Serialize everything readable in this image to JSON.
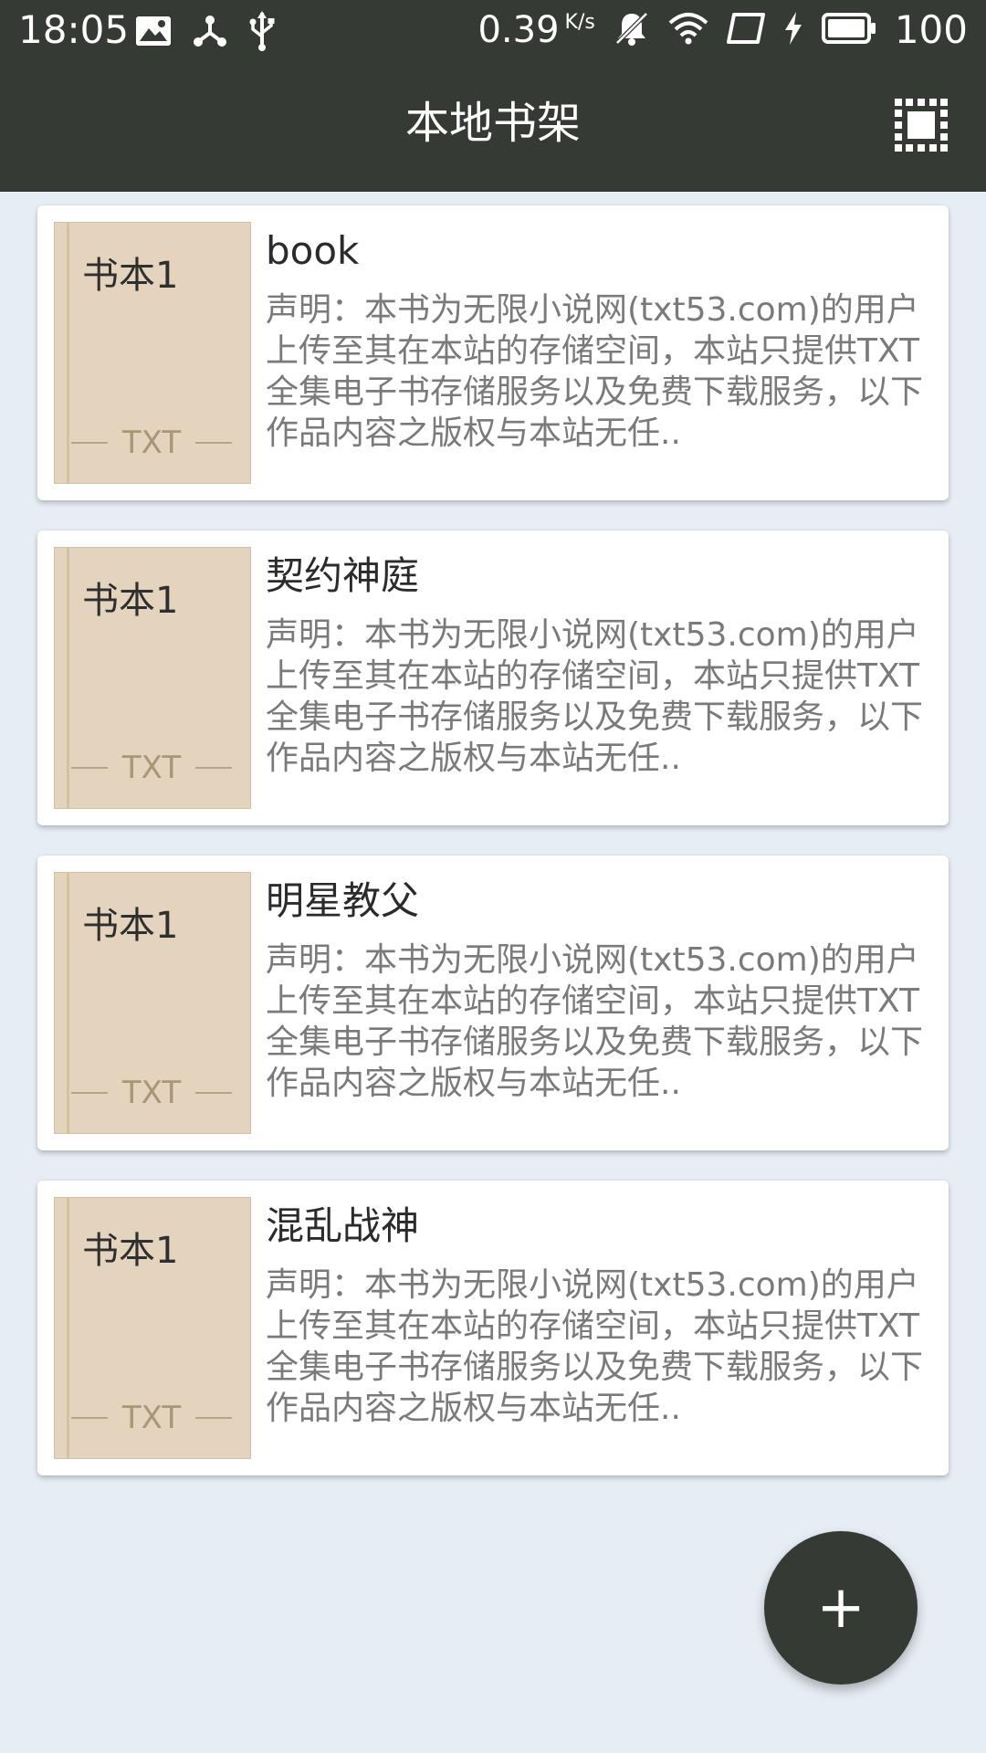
{
  "status_bar": {
    "time": "18:05",
    "net_speed_value": "0.39",
    "net_speed_unit": "K/s",
    "battery_level": "100",
    "icons": [
      "image-icon",
      "share-icon",
      "usb-icon",
      "mute-icon",
      "wifi-icon",
      "screen-icon",
      "charging-icon",
      "battery-icon"
    ]
  },
  "toolbar": {
    "title": "本地书架",
    "action_icon": "select-all-icon"
  },
  "books": [
    {
      "name": "book",
      "cover_title": "书本1",
      "cover_format": "TXT",
      "description": "声明：本书为无限小说网(txt53.com)的用户上传至其在本站的存储空间，本站只提供TXT全集电子书存储服务以及免费下载服务，以下作品内容之版权与本站无任.."
    },
    {
      "name": "契约神庭",
      "cover_title": "书本1",
      "cover_format": "TXT",
      "description": "声明：本书为无限小说网(txt53.com)的用户上传至其在本站的存储空间，本站只提供TXT全集电子书存储服务以及免费下载服务，以下作品内容之版权与本站无任.."
    },
    {
      "name": "明星教父",
      "cover_title": "书本1",
      "cover_format": "TXT",
      "description": "声明：本书为无限小说网(txt53.com)的用户上传至其在本站的存储空间，本站只提供TXT全集电子书存储服务以及免费下载服务，以下作品内容之版权与本站无任.."
    },
    {
      "name": "混乱战神",
      "cover_title": "书本1",
      "cover_format": "TXT",
      "description": "声明：本书为无限小说网(txt53.com)的用户上传至其在本站的存储空间，本站只提供TXT全集电子书存储服务以及免费下载服务，以下作品内容之版权与本站无任.."
    }
  ],
  "fab": {
    "label": "+",
    "icon": "add-icon"
  },
  "colors": {
    "toolbar_bg": "#363a34",
    "page_bg": "#e7edf4",
    "cover_bg": "#e5d4bd",
    "fab_bg": "#363a34"
  }
}
